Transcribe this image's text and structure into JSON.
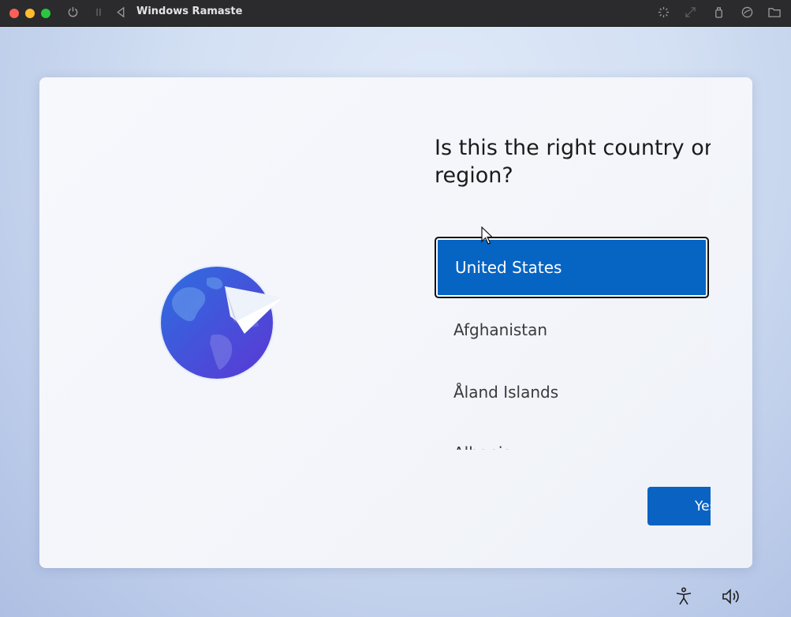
{
  "window": {
    "title": "Windows Ramaste"
  },
  "oobe": {
    "heading": "Is this the right country or region?",
    "countries": [
      {
        "label": "United States",
        "selected": true
      },
      {
        "label": "Afghanistan",
        "selected": false
      },
      {
        "label": "Åland Islands",
        "selected": false
      },
      {
        "label": "Albania",
        "selected": false
      }
    ],
    "yes_label": "Yes"
  },
  "icons": {
    "titlebar": [
      "power-icon",
      "pause-icon",
      "back-icon",
      "loading-icon",
      "resize-icon",
      "usb-icon",
      "share-icon",
      "folder-icon"
    ],
    "tray": [
      "accessibility-icon",
      "volume-icon"
    ]
  },
  "colors": {
    "accent": "#0664c3",
    "titlebar": "#2b2b2d"
  }
}
